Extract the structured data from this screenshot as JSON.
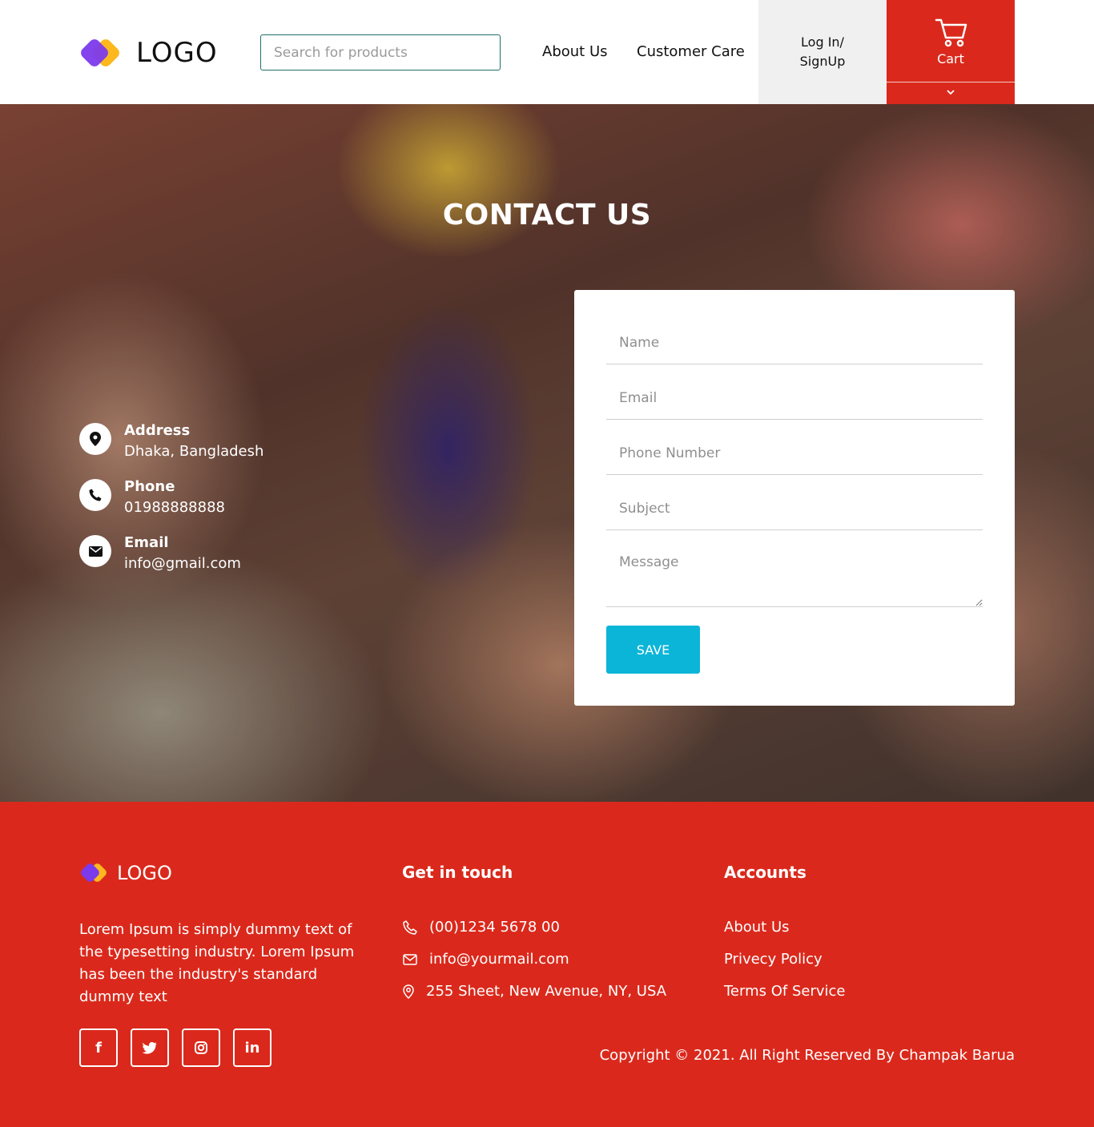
{
  "header": {
    "logo_text": "LOGO",
    "search_placeholder": "Search for products",
    "nav": [
      "About Us",
      "Customer Care"
    ],
    "login_label": "Log In/ SignUp",
    "cart_label": "Cart"
  },
  "hero": {
    "title": "CONTACT US",
    "info": [
      {
        "label": "Address",
        "value": "Dhaka, Bangladesh",
        "icon": "location-pin-icon"
      },
      {
        "label": "Phone",
        "value": "01988888888",
        "icon": "phone-icon"
      },
      {
        "label": "Email",
        "value": "info@gmail.com",
        "icon": "envelope-icon"
      }
    ]
  },
  "form": {
    "name_placeholder": "Name",
    "email_placeholder": "Email",
    "phone_placeholder": "Phone Number",
    "subject_placeholder": "Subject",
    "message_placeholder": "Message",
    "save_label": "SAVE"
  },
  "footer": {
    "logo_text": "LOGO",
    "description": "Lorem Ipsum is simply dummy text of the typesetting industry. Lorem Ipsum has been the industry's standard dummy text",
    "get_in_touch_heading": "Get in touch",
    "contact": [
      {
        "text": "(00)1234 5678 00",
        "icon": "phone-icon"
      },
      {
        "text": "info@yourmail.com",
        "icon": "envelope-icon"
      },
      {
        "text": "255 Sheet, New Avenue, NY, USA",
        "icon": "location-pin-icon"
      }
    ],
    "accounts_heading": "Accounts",
    "accounts_links": [
      "About Us",
      "Privecy Policy",
      "Terms Of Service"
    ],
    "social": [
      {
        "glyph": "f",
        "icon": "facebook-icon"
      },
      {
        "glyph": "🐦",
        "icon": "twitter-icon"
      },
      {
        "glyph": "◎",
        "icon": "instagram-icon"
      },
      {
        "glyph": "in",
        "icon": "linkedin-icon"
      }
    ],
    "copyright": "Copyright © 2021. All Right Reserved By Champak Barua"
  },
  "colors": {
    "brand_red": "#da291c",
    "save_button": "#0bb5d8",
    "logo_purple": "#7c3aed",
    "logo_yellow": "#fcb81d"
  }
}
